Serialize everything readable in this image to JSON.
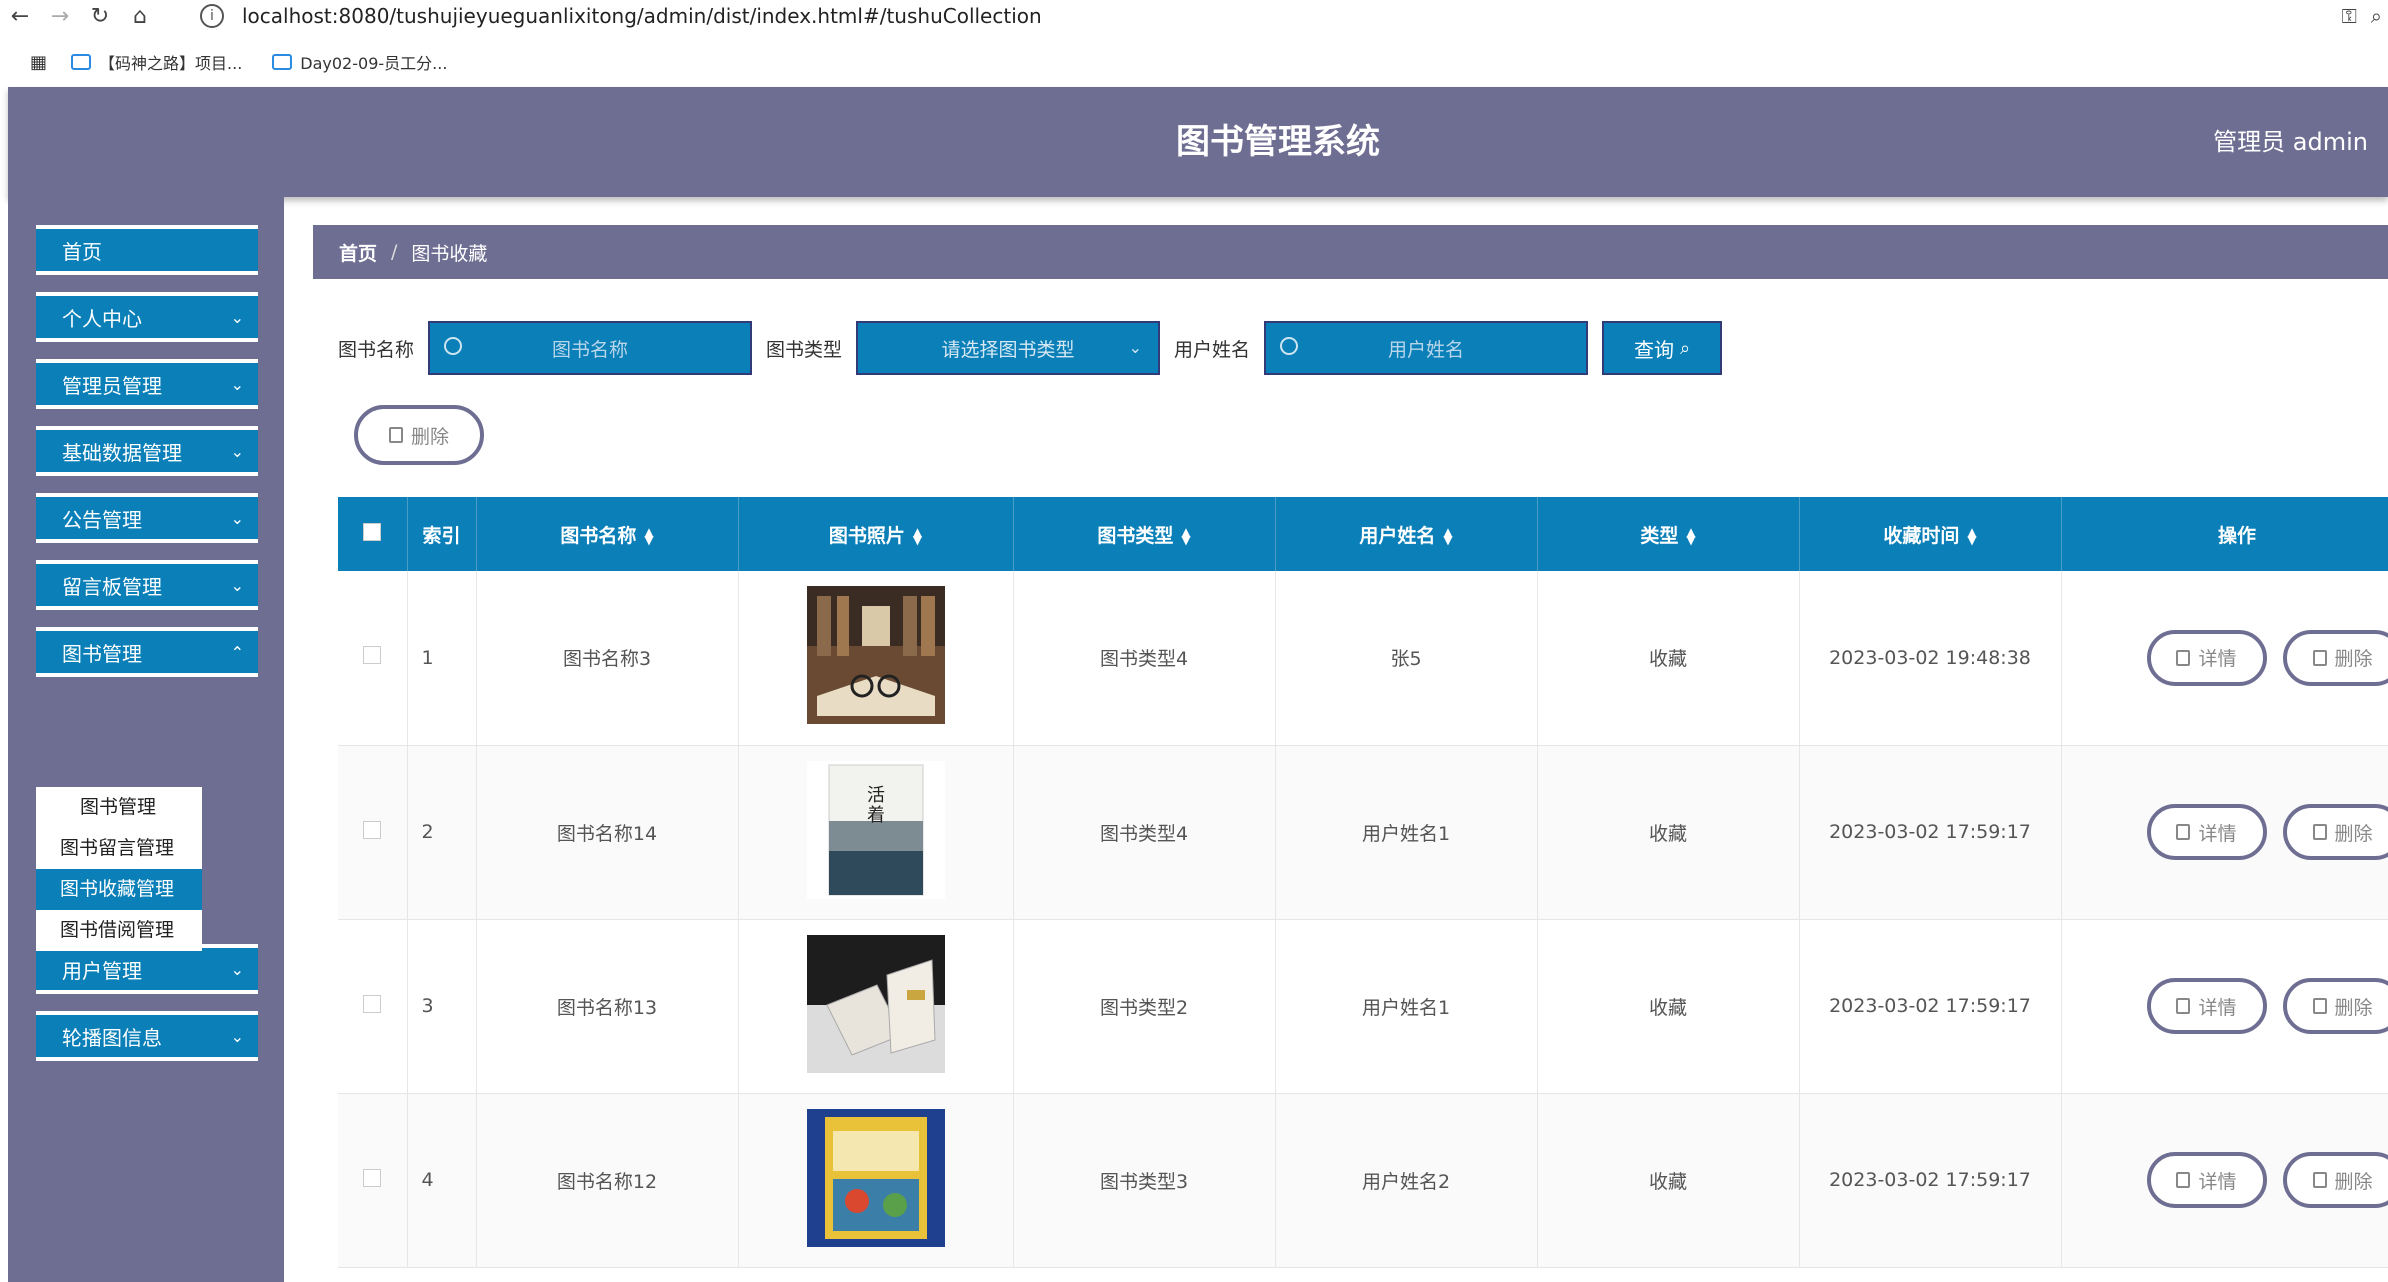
{
  "browser": {
    "url": "localhost:8080/tushujieyueguanlixitong/admin/dist/index.html#/tushuCollection",
    "bookmarks": [
      "【码神之路】项目...",
      "Day02-09-员工分..."
    ]
  },
  "header": {
    "title": "图书管理系统",
    "user": "管理员 admin"
  },
  "sidebar": {
    "items": [
      {
        "label": "首页"
      },
      {
        "label": "个人中心"
      },
      {
        "label": "管理员管理"
      },
      {
        "label": "基础数据管理"
      },
      {
        "label": "公告管理"
      },
      {
        "label": "留言板管理"
      },
      {
        "label": "图书管理"
      },
      {
        "label": "用户管理"
      },
      {
        "label": "轮播图信息"
      }
    ],
    "submenu": [
      "图书管理",
      "图书留言管理",
      "图书收藏管理",
      "图书借阅管理"
    ],
    "active_sub": "图书收藏管理"
  },
  "breadcrumb": {
    "home": "首页",
    "sep": "/",
    "current": "图书收藏"
  },
  "filters": {
    "book_name_label": "图书名称",
    "book_name_placeholder": "图书名称",
    "book_type_label": "图书类型",
    "book_type_placeholder": "请选择图书类型",
    "user_name_label": "用户姓名",
    "user_name_placeholder": "用户姓名",
    "query_label": "查询"
  },
  "toolbar": {
    "delete_label": "删除"
  },
  "table": {
    "headers": [
      "索引",
      "图书名称",
      "图书照片",
      "图书类型",
      "用户姓名",
      "类型",
      "收藏时间",
      "操作"
    ],
    "rows": [
      {
        "index": "1",
        "name": "图书名称3",
        "type": "图书类型4",
        "user": "张5",
        "kind": "收藏",
        "time": "2023-03-02 19:48:38"
      },
      {
        "index": "2",
        "name": "图书名称14",
        "type": "图书类型4",
        "user": "用户姓名1",
        "kind": "收藏",
        "time": "2023-03-02 17:59:17"
      },
      {
        "index": "3",
        "name": "图书名称13",
        "type": "图书类型2",
        "user": "用户姓名1",
        "kind": "收藏",
        "time": "2023-03-02 17:59:17"
      },
      {
        "index": "4",
        "name": "图书名称12",
        "type": "图书类型3",
        "user": "用户姓名2",
        "kind": "收藏",
        "time": "2023-03-02 17:59:17"
      }
    ],
    "detail_label": "详情",
    "delete_label": "删除"
  },
  "colors": {
    "header_bg": "#6e6d92",
    "accent": "#0a7fb8"
  }
}
